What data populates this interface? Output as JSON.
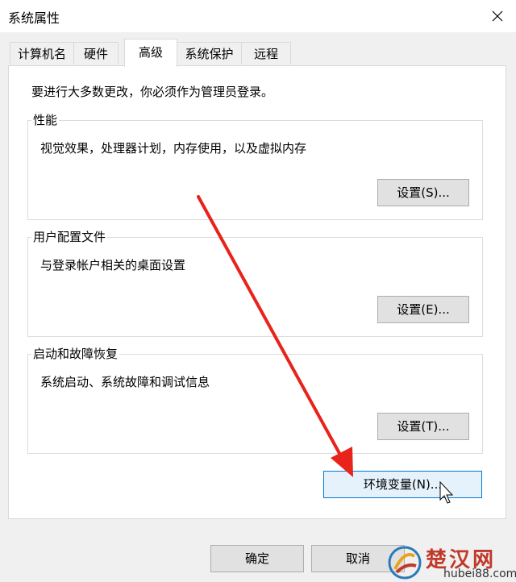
{
  "window": {
    "title": "系统属性"
  },
  "tabs": [
    {
      "label": "计算机名"
    },
    {
      "label": "硬件"
    },
    {
      "label": "高级"
    },
    {
      "label": "系统保护"
    },
    {
      "label": "远程"
    }
  ],
  "active_tab": "高级",
  "intro_text": "要进行大多数更改，你必须作为管理员登录。",
  "groups": {
    "performance": {
      "legend": "性能",
      "description": "视觉效果，处理器计划，内存使用，以及虚拟内存",
      "button": "设置(S)..."
    },
    "user_profiles": {
      "legend": "用户配置文件",
      "description": "与登录帐户相关的桌面设置",
      "button": "设置(E)..."
    },
    "startup_recovery": {
      "legend": "启动和故障恢复",
      "description": "系统启动、系统故障和调试信息",
      "button": "设置(T)..."
    }
  },
  "env_button": "环境变量(N)...",
  "footer": {
    "ok": "确定",
    "cancel": "取消"
  },
  "watermark": {
    "name": "楚汉网",
    "url": "hubei88.com"
  },
  "colors": {
    "arrow": "#e8231b",
    "hover_border": "#0078d7",
    "hover_bg": "#e5f1fb"
  }
}
